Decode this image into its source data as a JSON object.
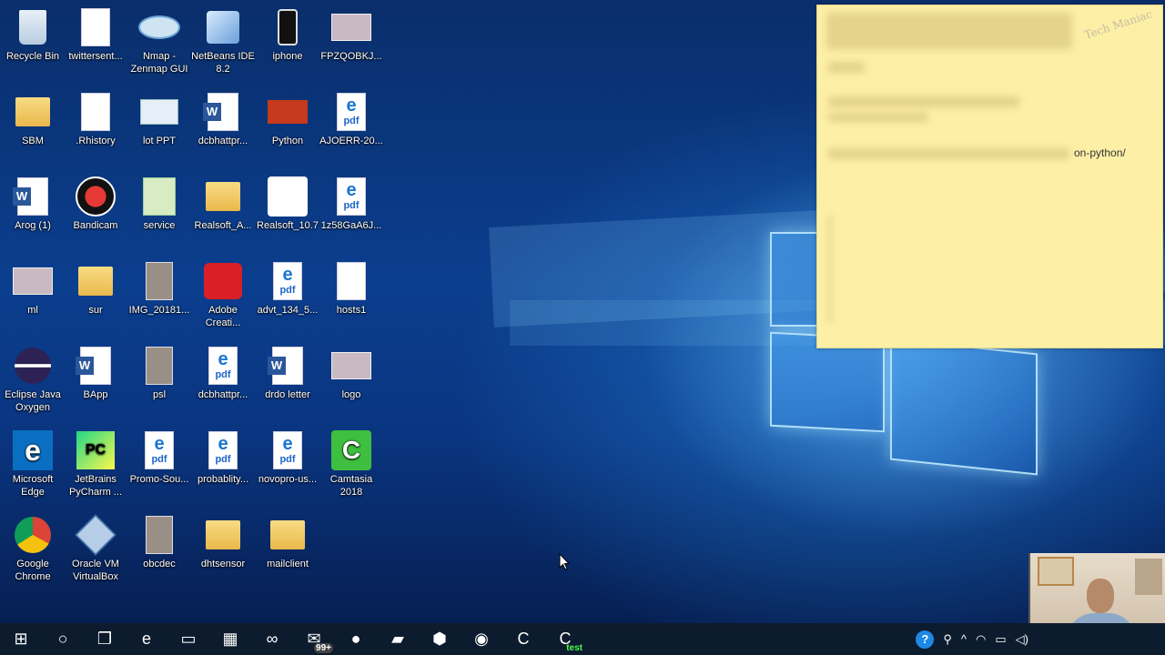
{
  "desktop": {
    "icons": [
      {
        "label": "Recycle Bin",
        "icon": "recycle-bin-icon"
      },
      {
        "label": "twittersent...",
        "icon": "document-icon"
      },
      {
        "label": "Nmap - Zenmap GUI",
        "icon": "eye-icon"
      },
      {
        "label": "NetBeans IDE 8.2",
        "icon": "cube-icon"
      },
      {
        "label": "iphone",
        "icon": "phone-icon"
      },
      {
        "label": "FPZQOBKJ...",
        "icon": "image-icon"
      },
      {
        "label": "SBM",
        "icon": "folder-icon"
      },
      {
        "label": ".Rhistory",
        "icon": "document-icon"
      },
      {
        "label": "lot PPT",
        "icon": "slides-icon"
      },
      {
        "label": "dcbhattpr...",
        "icon": "word-icon"
      },
      {
        "label": "Python",
        "icon": "powerpoint-icon"
      },
      {
        "label": "AJOERR-20...",
        "icon": "pdf-icon"
      },
      {
        "label": "Arog (1)",
        "icon": "word-icon"
      },
      {
        "label": "Bandicam",
        "icon": "record-icon"
      },
      {
        "label": "service",
        "icon": "spreadsheet-icon"
      },
      {
        "label": "Realsoft_A...",
        "icon": "folder-icon"
      },
      {
        "label": "Realsoft_10.7",
        "icon": "realsoft-icon"
      },
      {
        "label": "1z58GaA6J...",
        "icon": "pdf-icon"
      },
      {
        "label": "ml",
        "icon": "image-icon"
      },
      {
        "label": "sur",
        "icon": "folder-icon"
      },
      {
        "label": "IMG_20181...",
        "icon": "photo-icon"
      },
      {
        "label": "Adobe Creati...",
        "icon": "adobe-cc-icon"
      },
      {
        "label": "advt_134_5...",
        "icon": "pdf-icon"
      },
      {
        "label": "hosts1",
        "icon": "document-icon"
      },
      {
        "label": "Eclipse Java Oxygen",
        "icon": "eclipse-icon"
      },
      {
        "label": "BApp",
        "icon": "word-icon"
      },
      {
        "label": "psl",
        "icon": "photo-icon"
      },
      {
        "label": "dcbhattpr...",
        "icon": "pdf-icon"
      },
      {
        "label": "drdo letter",
        "icon": "word-icon"
      },
      {
        "label": "logo",
        "icon": "image-icon"
      },
      {
        "label": "Microsoft Edge",
        "icon": "edge-icon"
      },
      {
        "label": "JetBrains PyCharm ...",
        "icon": "pycharm-icon"
      },
      {
        "label": "Promo-Sou...",
        "icon": "pdf-icon"
      },
      {
        "label": "probablity...",
        "icon": "pdf-icon"
      },
      {
        "label": "novopro-us...",
        "icon": "pdf-icon"
      },
      {
        "label": "Camtasia 2018",
        "icon": "camtasia-icon"
      },
      {
        "label": "Google Chrome",
        "icon": "chrome-icon"
      },
      {
        "label": "Oracle VM VirtualBox",
        "icon": "virtualbox-icon"
      },
      {
        "label": "obcdec",
        "icon": "photo-icon"
      },
      {
        "label": "dhtsensor",
        "icon": "folder-icon"
      },
      {
        "label": "mailclient",
        "icon": "folder-icon"
      }
    ]
  },
  "sticky_note": {
    "visible_text": "on-python/",
    "watermark": "Tech Maniac"
  },
  "taskbar": {
    "items": [
      {
        "icon": "windows-start-icon",
        "glyph": "⊞"
      },
      {
        "icon": "cortana-search-icon",
        "glyph": "○"
      },
      {
        "icon": "task-view-icon",
        "glyph": "❐"
      },
      {
        "icon": "edge-icon",
        "glyph": "e"
      },
      {
        "icon": "file-explorer-icon",
        "glyph": "▭"
      },
      {
        "icon": "store-icon",
        "glyph": "▦"
      },
      {
        "icon": "arduino-icon",
        "glyph": "∞"
      },
      {
        "icon": "mail-icon",
        "glyph": "✉",
        "badge": "99+"
      },
      {
        "icon": "green-ball-icon",
        "glyph": "●"
      },
      {
        "icon": "sticky-notes-icon",
        "glyph": "▰"
      },
      {
        "icon": "virtualbox-icon",
        "glyph": "⬢"
      },
      {
        "icon": "chrome-icon",
        "glyph": "◉"
      },
      {
        "icon": "camtasia-icon",
        "glyph": "C"
      },
      {
        "icon": "camtasia-recorder-icon",
        "glyph": "C",
        "badge": "test"
      }
    ],
    "tray": [
      {
        "icon": "help-icon",
        "glyph": "?"
      },
      {
        "icon": "people-icon",
        "glyph": "⚲"
      },
      {
        "icon": "chevron-up-icon",
        "glyph": "^"
      },
      {
        "icon": "wifi-icon",
        "glyph": "◠"
      },
      {
        "icon": "battery-icon",
        "glyph": "▭"
      },
      {
        "icon": "volume-icon",
        "glyph": "◁)"
      }
    ]
  }
}
